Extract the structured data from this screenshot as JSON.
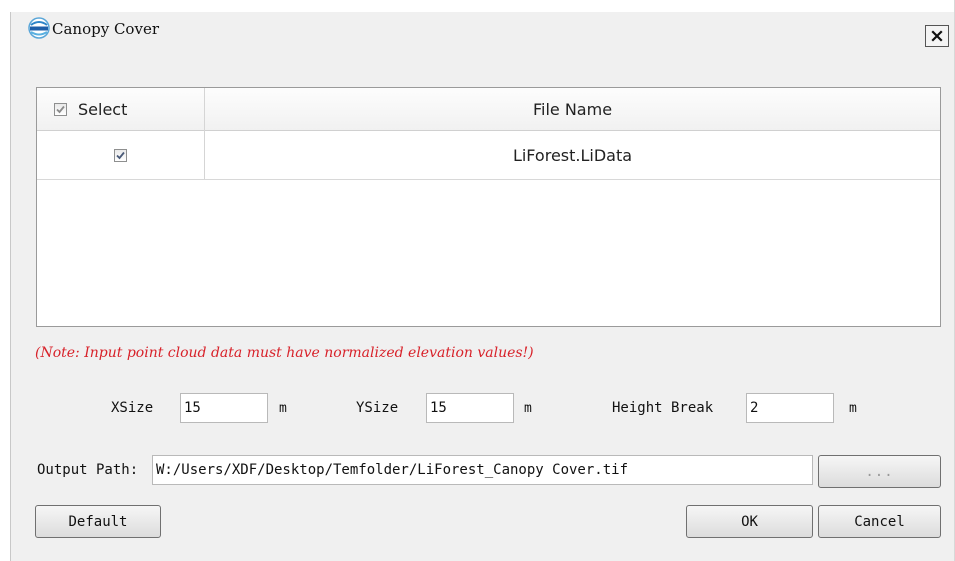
{
  "window": {
    "title": "Canopy Cover",
    "icon": "lidar-logo-icon",
    "close_icon": "close-icon"
  },
  "table": {
    "header": {
      "select_label": "Select",
      "select_checked": true,
      "file_name_label": "File Name"
    },
    "rows": [
      {
        "selected": true,
        "file_name": "LiForest.LiData"
      }
    ]
  },
  "note": "(Note: Input point cloud data must have normalized elevation values!)",
  "params": {
    "xsize": {
      "label": "XSize",
      "value": "15",
      "unit": "m"
    },
    "ysize": {
      "label": "YSize",
      "value": "15",
      "unit": "m"
    },
    "height_break": {
      "label": "Height Break",
      "value": "2",
      "unit": "m"
    }
  },
  "output": {
    "label": "Output Path:",
    "value": "W:/Users/XDF/Desktop/Temfolder/LiForest_Canopy Cover.tif",
    "browse_label": "..."
  },
  "buttons": {
    "default": "Default",
    "ok": "OK",
    "cancel": "Cancel"
  },
  "colors": {
    "note": "#d8222a",
    "dialog_bg": "#f0f0f0"
  }
}
